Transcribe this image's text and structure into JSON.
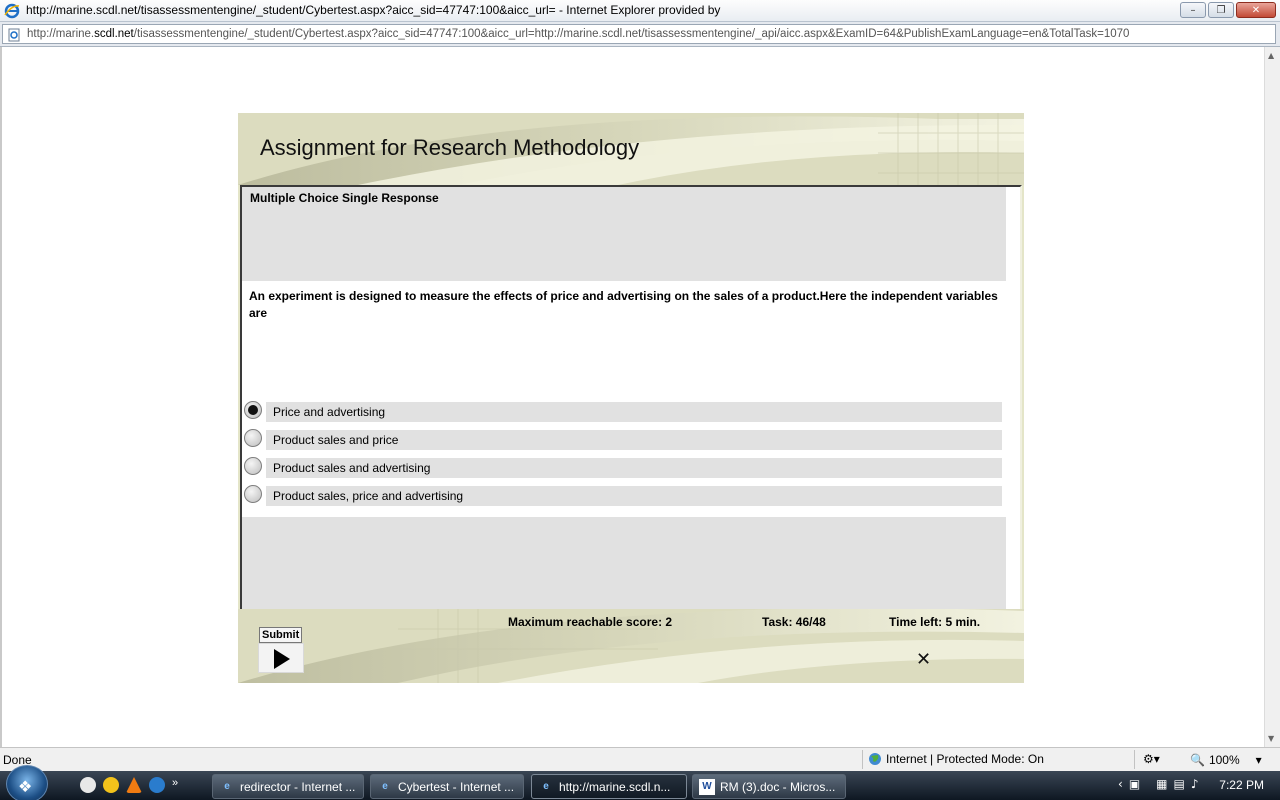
{
  "window": {
    "title": "http://marine.scdl.net/tisassessmentengine/_student/Cybertest.aspx?aicc_sid=47747:100&aicc_url= - Internet Explorer provided by",
    "address_prefix": "http://marine.",
    "address_domain": "scdl.net",
    "address_rest": "/tisassessmentengine/_student/Cybertest.aspx?aicc_sid=47747:100&aicc_url=http://marine.scdl.net/tisassessmentengine/_api/aicc.aspx&ExamID=64&PublishExamLanguage=en&TotalTask=1070"
  },
  "exam": {
    "title": "Assignment for Research Methodology",
    "question_type": "Multiple Choice Single Response",
    "question": "An experiment is designed to measure the effects of price and advertising on the sales of a product.Here the independent variables are",
    "options": [
      {
        "label": "Price and advertising",
        "selected": true
      },
      {
        "label": "Product sales and price",
        "selected": false
      },
      {
        "label": "Product sales and advertising",
        "selected": false
      },
      {
        "label": "Product sales, price and advertising",
        "selected": false
      }
    ],
    "max_score": "Maximum reachable score: 2",
    "task": "Task: 46/48",
    "time_left": "Time left: 5 min.",
    "submit_label": "Submit"
  },
  "statusbar": {
    "status": "Done",
    "zone": "Internet | Protected Mode: On",
    "zoom": "100%"
  },
  "taskbar": {
    "buttons": [
      {
        "label": "redirector - Internet ...",
        "icon": "ie-icon"
      },
      {
        "label": "Cybertest - Internet ...",
        "icon": "ie-icon"
      },
      {
        "label": "http://marine.scdl.n...",
        "icon": "ie-icon"
      },
      {
        "label": "RM (3).doc - Micros...",
        "icon": "word-icon"
      }
    ],
    "clock": "7:22 PM"
  },
  "colors": {
    "exam_bg": "#e4e5c8",
    "gray_panel": "#e1e1e1",
    "taskbar": "#1b2632"
  }
}
